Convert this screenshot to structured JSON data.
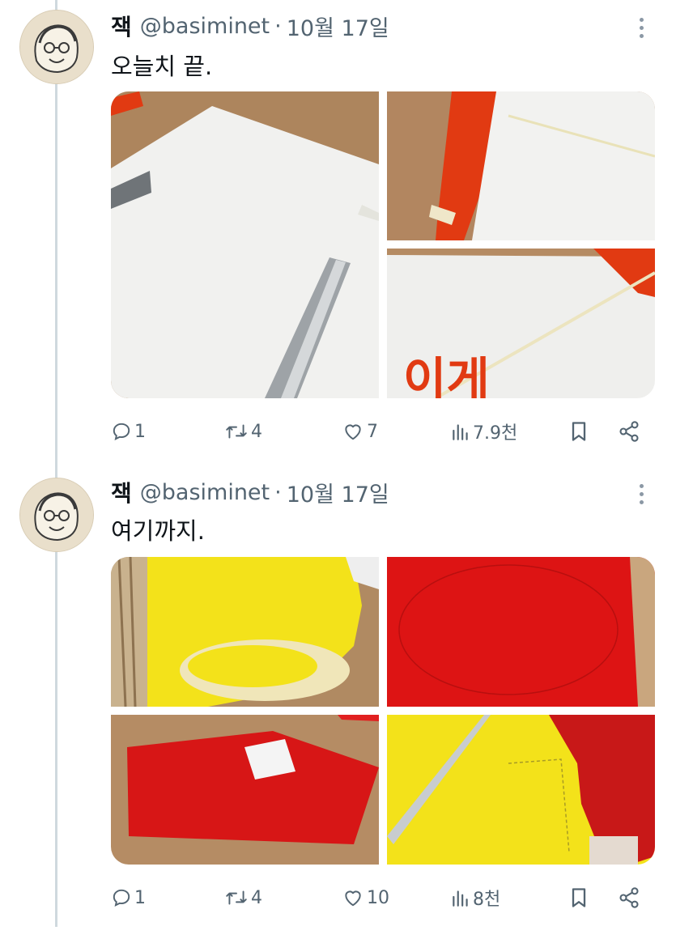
{
  "tweets": [
    {
      "display_name": "잭",
      "handle": "@basiminet",
      "separator": "·",
      "date": "10월 17일",
      "text": "오늘치 끝.",
      "media_text": "이게",
      "stats": {
        "replies": "1",
        "retweets": "4",
        "likes": "7",
        "views": "7.9천"
      }
    },
    {
      "display_name": "잭",
      "handle": "@basiminet",
      "separator": "·",
      "date": "10월 17일",
      "text": "여기까지.",
      "stats": {
        "replies": "1",
        "retweets": "4",
        "likes": "10",
        "views": "8천"
      }
    }
  ],
  "icons": {
    "reply": "reply-icon",
    "retweet": "retweet-icon",
    "like": "heart-icon",
    "views": "views-chart-icon",
    "bookmark": "bookmark-icon",
    "share": "share-icon",
    "more": "more-icon"
  },
  "colors": {
    "text": "#0f1419",
    "secondary": "#536471",
    "thread_line": "#cfd9de",
    "accent_red": "#e13a12",
    "paper_yellow": "#f3e21a",
    "paper_red": "#dd1414"
  }
}
